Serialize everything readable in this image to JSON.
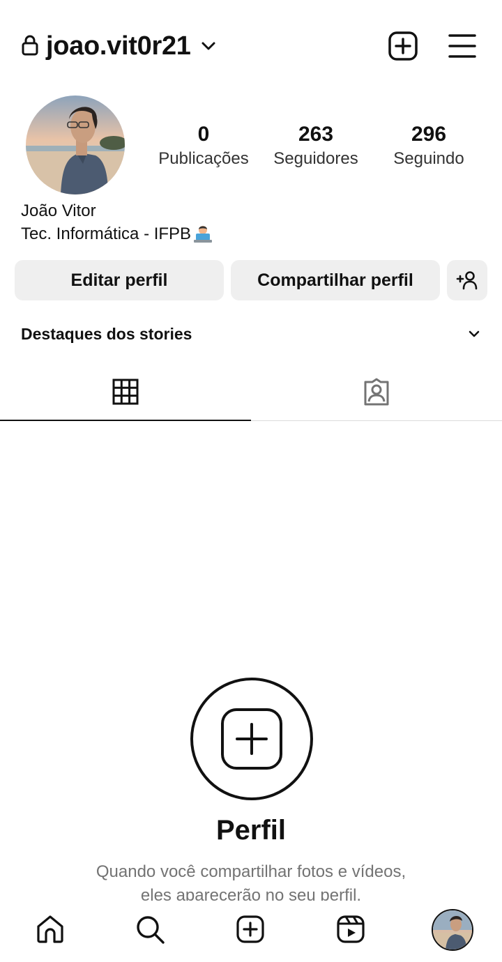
{
  "header": {
    "username": "joao.vit0r21",
    "icons": {
      "lock": "lock-icon",
      "dropdown": "chevron-down-icon",
      "create": "add-post-icon",
      "menu": "menu-icon"
    }
  },
  "profile": {
    "stats": [
      {
        "value": "0",
        "label": "Publicações"
      },
      {
        "value": "263",
        "label": "Seguidores"
      },
      {
        "value": "296",
        "label": "Seguindo"
      }
    ],
    "name": "João Vitor",
    "bio": "Tec. Informática - IFPB"
  },
  "buttons": {
    "edit": "Editar perfil",
    "share": "Compartilhar perfil",
    "discover": "add-person-icon"
  },
  "highlights": {
    "label": "Destaques dos stories"
  },
  "tabs": [
    {
      "name": "posts-grid",
      "icon": "grid-icon",
      "active": true
    },
    {
      "name": "tagged",
      "icon": "tagged-person-icon",
      "active": false
    }
  ],
  "empty_state": {
    "title": "Perfil",
    "line1": "Quando você compartilhar fotos e vídeos,",
    "line2": "eles aparecerão no seu perfil."
  },
  "bottom_nav": [
    {
      "name": "home",
      "icon": "home-icon"
    },
    {
      "name": "search",
      "icon": "search-icon"
    },
    {
      "name": "create",
      "icon": "add-post-icon"
    },
    {
      "name": "reels",
      "icon": "reels-icon"
    },
    {
      "name": "profile",
      "icon": "profile-avatar-icon"
    }
  ]
}
